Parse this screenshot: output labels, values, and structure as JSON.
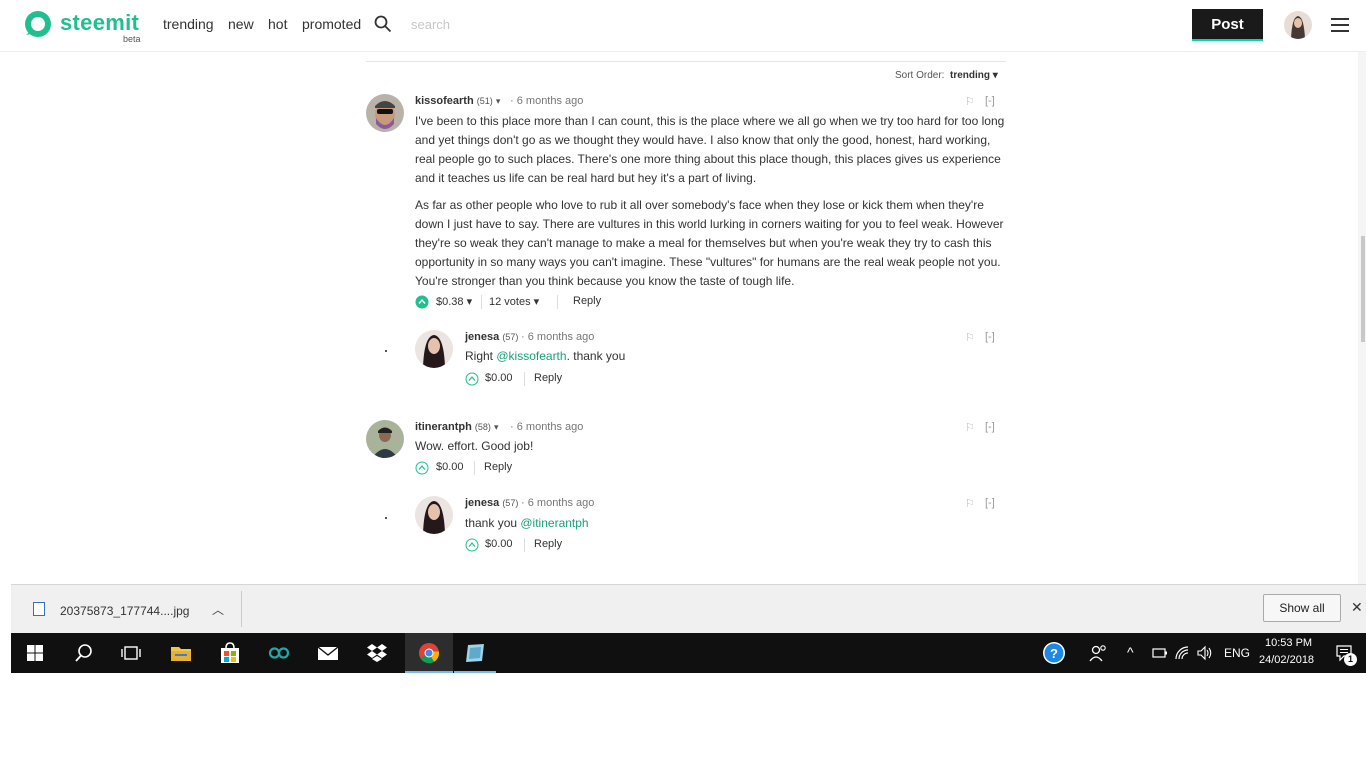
{
  "header": {
    "logo_text": "steemit",
    "logo_beta": "beta",
    "nav": [
      "trending",
      "new",
      "hot",
      "promoted"
    ],
    "search_placeholder": "search",
    "post_label": "Post"
  },
  "sort": {
    "label": "Sort Order:",
    "value": "trending"
  },
  "comments": [
    {
      "author": "kissofearth",
      "rep": "(51)",
      "time": "6 months ago",
      "paragraphs": [
        "I've been to this place more than I can count, this is the place where we all go when we try too hard for too long and yet things don't go as we thought they would have. I also know that only the good, honest, hard working, real people go to such places. There's one more thing about this place though, this places gives us experience and it teaches us life can be real hard but hey it's a part of living.",
        "As far as other people who love to rub it all over somebody's face when they lose or kick them when they're down I just have to say. There are vultures in this world lurking in corners waiting for you to feel weak. However they're so weak they can't manage to make a meal for themselves but when you're weak they try to cash this opportunity in so many ways you can't imagine. These \"vultures\" for humans are the real weak people not you. You're stronger than you think because you know the taste of tough life."
      ],
      "payout": "$0.38",
      "votes": "12 votes",
      "reply": "Reply",
      "flag": "⚐",
      "collapse": "[-]"
    },
    {
      "author": "jenesa",
      "rep": "(57)",
      "time": "6 months ago",
      "text_before": "Right ",
      "mention": "@kissofearth",
      "text_after": ". thank you",
      "payout": "$0.00",
      "reply": "Reply",
      "flag": "⚐",
      "collapse": "[-]"
    },
    {
      "author": "itinerantph",
      "rep": "(58)",
      "time": "6 months ago",
      "text": "Wow. effort. Good job!",
      "payout": "$0.00",
      "reply": "Reply",
      "flag": "⚐",
      "collapse": "[-]"
    },
    {
      "author": "jenesa",
      "rep": "(57)",
      "time": "6 months ago",
      "text_before": "thank you ",
      "mention": "@itinerantph",
      "payout": "$0.00",
      "reply": "Reply",
      "flag": "⚐",
      "collapse": "[-]"
    }
  ],
  "download_bar": {
    "filename": "20375873_177744....jpg",
    "show_all": "Show all"
  },
  "taskbar": {
    "lang": "ENG",
    "time": "10:53 PM",
    "date": "24/02/2018",
    "notification_count": "1"
  },
  "colors": {
    "accent": "#1fbf8f",
    "mention": "#1a9e7a",
    "post_button": "#1a1a1a",
    "taskbar": "#101010"
  }
}
